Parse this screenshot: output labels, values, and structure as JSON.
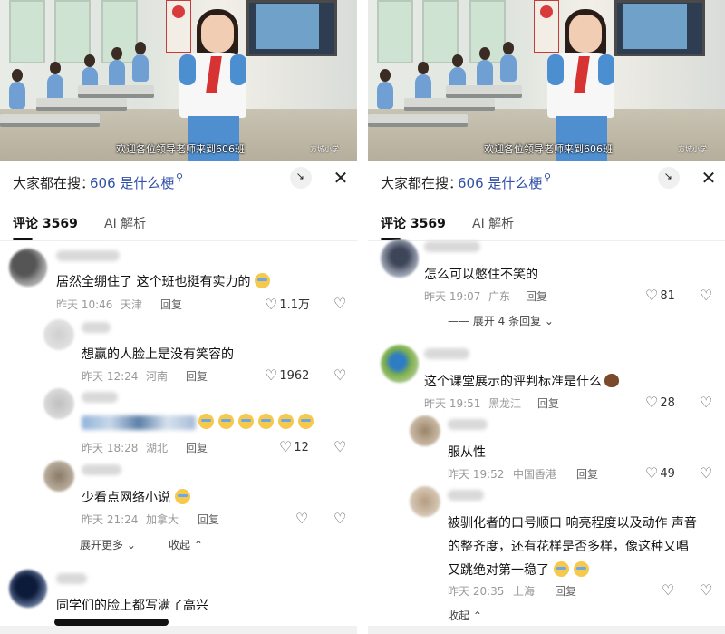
{
  "left": {
    "video": {
      "caption": "欢迎各位领导老师来到606班",
      "watermark": "方城小学"
    },
    "search": {
      "prefix": "大家都在搜：",
      "query": "606 是什么梗"
    },
    "tabs": {
      "comments": "评论 3569",
      "ai": "AI 解析"
    },
    "comments": [
      {
        "text": "居然全绷住了 这个班也挺有实力的",
        "time": "昨天 10:46",
        "location": "天津",
        "reply": "回复",
        "likes": "1.1万"
      },
      {
        "text": "想赢的人脸上是没有笑容的",
        "time": "昨天 12:24",
        "location": "河南",
        "reply": "回复",
        "likes": "1962"
      },
      {
        "text": "",
        "time": "昨天 18:28",
        "location": "湖北",
        "reply": "回复",
        "likes": "12"
      },
      {
        "text": "少看点网络小说",
        "time": "昨天 21:24",
        "location": "加拿大",
        "reply": "回复",
        "likes": ""
      },
      {
        "text": "同学们的脸上都写满了高兴"
      }
    ],
    "expand_more": "展开更多",
    "collapse": "收起"
  },
  "right": {
    "video": {
      "caption": "欢迎各位领导老师来到606班",
      "watermark": "方城小学"
    },
    "search": {
      "prefix": "大家都在搜：",
      "query": "606 是什么梗"
    },
    "tabs": {
      "comments": "评论 3569",
      "ai": "AI 解析"
    },
    "comments": [
      {
        "text": "怎么可以憋住不笑的",
        "time": "昨天 19:07",
        "location": "广东",
        "reply": "回复",
        "likes": "81"
      },
      {
        "text": "这个课堂展示的评判标准是什么",
        "time": "昨天 19:51",
        "location": "黑龙江",
        "reply": "回复",
        "likes": "28"
      },
      {
        "text": "服从性",
        "time": "昨天 19:52",
        "location": "中国香港",
        "reply": "回复",
        "likes": "49"
      },
      {
        "line1": "被驯化者的口号顺口 响亮程度以及动作 声音",
        "line2": "的整齐度，还有花样是否多样，像这种又唱",
        "line3": "又跳绝对第一稳了",
        "time": "昨天 20:35",
        "location": "上海",
        "reply": "回复",
        "likes": ""
      }
    ],
    "expand_replies": "展开 4 条回复",
    "collapse": "收起"
  },
  "icons": {
    "like": "heart-outline-icon",
    "dislike": "broken-heart-icon",
    "close": "close-icon",
    "expand": "expand-icon",
    "search": "search-icon"
  },
  "colors": {
    "query": "#2f4fa8",
    "meta": "#999999"
  }
}
